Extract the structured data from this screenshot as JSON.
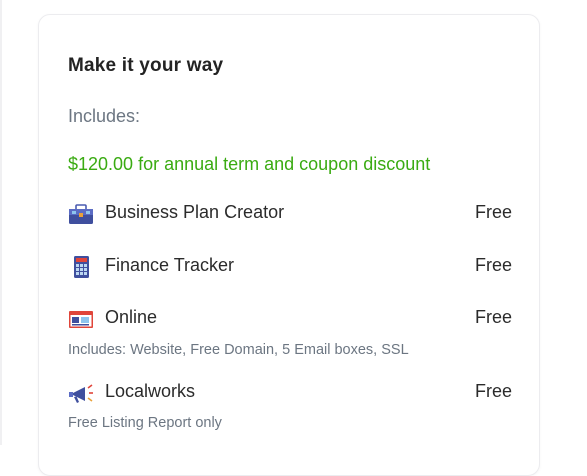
{
  "card": {
    "title": "Make it your way",
    "includes_label": "Includes:",
    "discount_text": "$120.00 for annual term and coupon discount",
    "items": [
      {
        "name": "Business Plan Creator",
        "price": "Free",
        "icon": "briefcase-icon"
      },
      {
        "name": "Finance Tracker",
        "price": "Free",
        "icon": "calculator-icon"
      },
      {
        "name": "Online",
        "price": "Free",
        "icon": "browser-window-icon",
        "note": "Includes: Website, Free Domain, 5 Email boxes, SSL"
      },
      {
        "name": "Localworks",
        "price": "Free",
        "icon": "megaphone-icon",
        "note": "Free Listing Report only"
      }
    ]
  },
  "colors": {
    "discount_green": "#3aab12",
    "muted_text": "#6c7682",
    "primary_text": "#2b2b2b"
  }
}
